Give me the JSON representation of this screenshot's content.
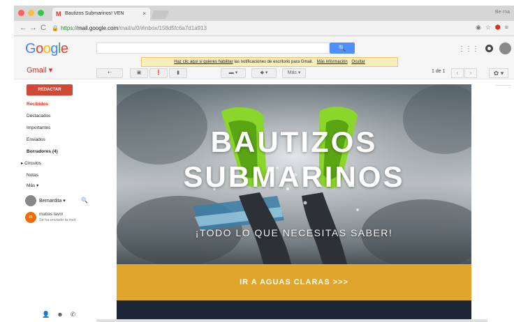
{
  "browser": {
    "tab_title": "Bautizos Submarinos! VEN",
    "tab_close": "×",
    "profile_label": "Be·rna",
    "url_scheme": "https://",
    "url_host": "mail.google.com",
    "url_path": "/mail/u/0/#inbox/158d5fc6a7d1a913",
    "nav_back": "←",
    "nav_forward": "→",
    "nav_reload": "C",
    "lock": "🔒",
    "star": "☆"
  },
  "gmail": {
    "logo_letters": [
      {
        "ch": "G",
        "color": "#4285f4"
      },
      {
        "ch": "o",
        "color": "#ea4335"
      },
      {
        "ch": "o",
        "color": "#fbbc05"
      },
      {
        "ch": "g",
        "color": "#4285f4"
      },
      {
        "ch": "l",
        "color": "#34a853"
      },
      {
        "ch": "e",
        "color": "#ea4335"
      }
    ],
    "search_icon": "🔍",
    "apps_icon": "⋮⋮⋮",
    "notice": {
      "text_link": "Haz clic aquí si quieres habilitar",
      "text_rest": "las notificaciones de escritorio para Gmail.",
      "more_info": "Más información",
      "hide": "Ocultar"
    },
    "app_label": "Gmail ▾",
    "toolbar": {
      "back": "⇠",
      "archive": "▣",
      "report": "❗",
      "delete": "▮",
      "folder": "▬ ▾",
      "labels": "◆ ▾",
      "more": "Más ▾",
      "pager": "1 de 1",
      "prev": "‹",
      "next": "›",
      "settings": "✿ ▾"
    }
  },
  "sidebar": {
    "compose": "REDACTAR",
    "items": [
      {
        "label": "Recibidos",
        "state": "active"
      },
      {
        "label": "Destacados",
        "state": ""
      },
      {
        "label": "Importantes",
        "state": ""
      },
      {
        "label": "Enviados",
        "state": ""
      },
      {
        "label": "Borradores (4)",
        "state": "bold"
      },
      {
        "label": "▸ Círculos",
        "state": ""
      },
      {
        "label": "Notas",
        "state": ""
      },
      {
        "label": "Más ▾",
        "state": ""
      }
    ],
    "hangouts_user": "Bernardita ▾",
    "hangouts_search": "🔍",
    "contact": {
      "initial": "m",
      "name": "matias lavin",
      "status": "Se ha enviado la invit"
    },
    "bottom_icons": [
      "👤",
      "☻",
      "✆"
    ]
  },
  "email": {
    "hero_title_line1": "BAUTIZOS",
    "hero_title_line2": "SUBMARINOS",
    "hero_subtitle": "¡TODO LO QUE NECESITAS SABER!",
    "cta": "IR A AGUAS CLARAS >>>"
  }
}
